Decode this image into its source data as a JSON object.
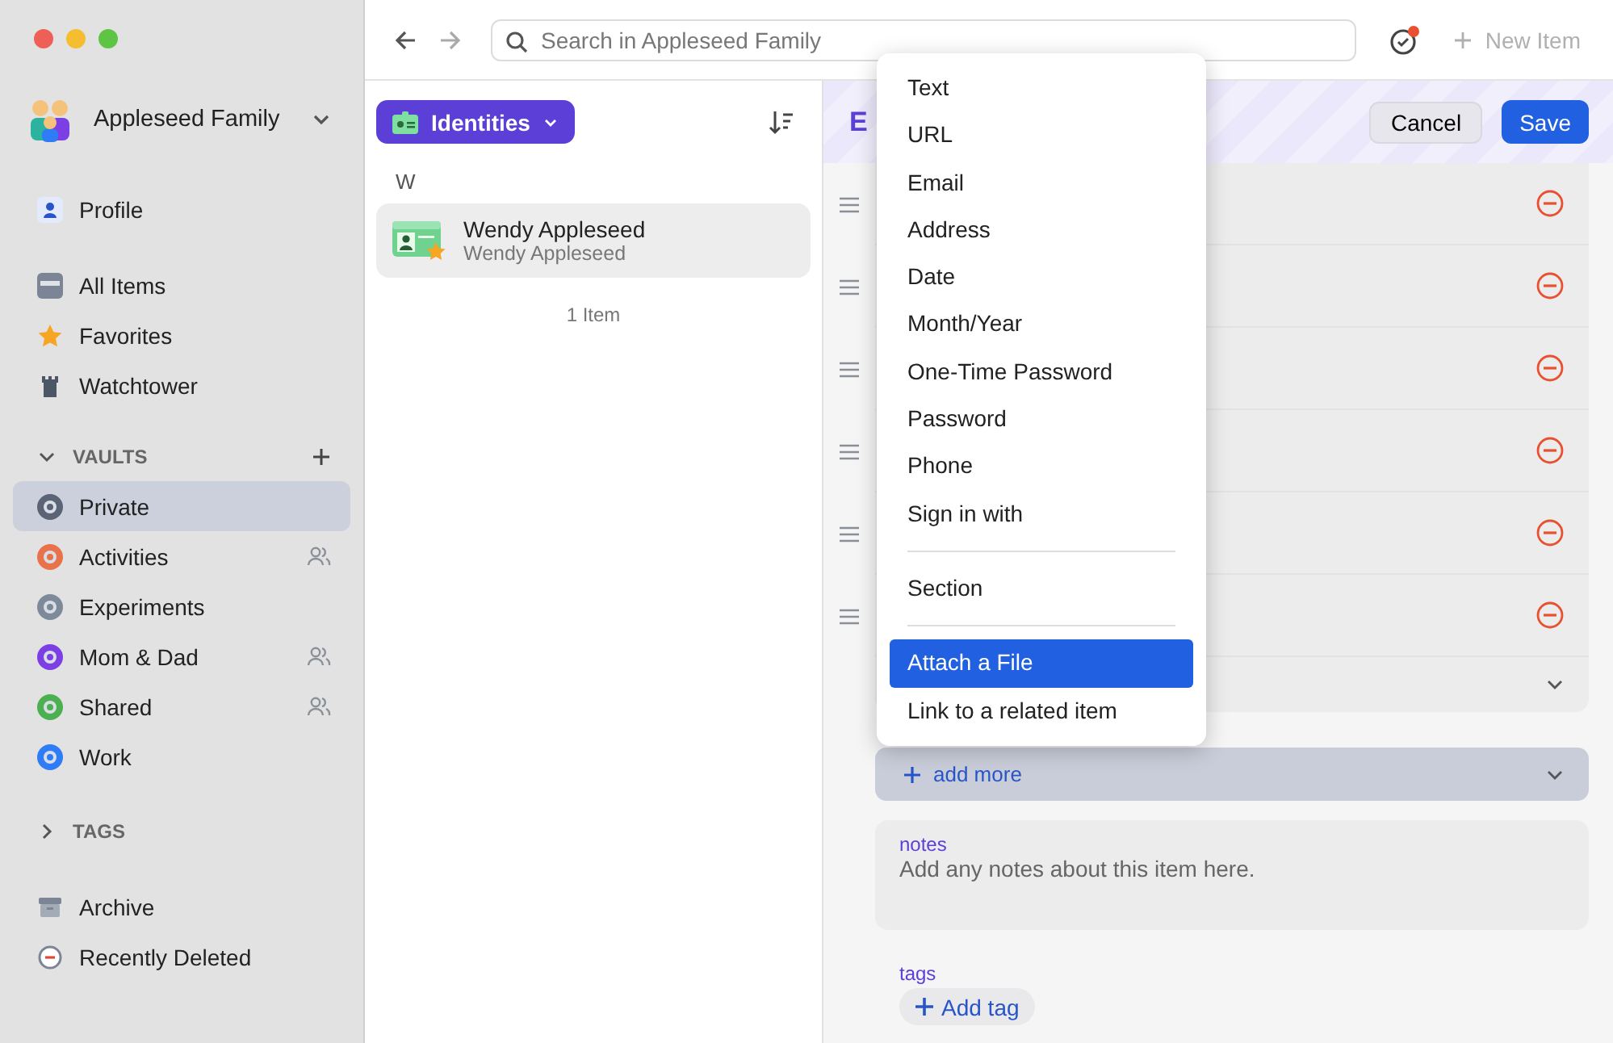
{
  "sidebar": {
    "account": "Appleseed Family",
    "groups": [
      {
        "items": [
          {
            "label": "Profile",
            "selected": false
          }
        ]
      },
      {
        "items": [
          {
            "label": "All Items",
            "selected": false
          },
          {
            "label": "Favorites",
            "selected": false
          },
          {
            "label": "Watchtower",
            "selected": false
          }
        ]
      }
    ],
    "vaults": {
      "title": "VAULTS",
      "expanded": true,
      "items": [
        {
          "label": "Private",
          "selected": true,
          "shared": false
        },
        {
          "label": "Activities",
          "selected": false,
          "shared": true
        },
        {
          "label": "Experiments",
          "selected": false,
          "shared": false
        },
        {
          "label": "Mom & Dad",
          "selected": false,
          "shared": true
        },
        {
          "label": "Shared",
          "selected": false,
          "shared": true
        },
        {
          "label": "Work",
          "selected": false,
          "shared": false
        }
      ]
    },
    "tags": {
      "title": "TAGS",
      "expanded": false
    },
    "bottom": [
      {
        "label": "Archive",
        "selected": false
      },
      {
        "label": "Recently Deleted",
        "selected": false
      }
    ]
  },
  "toolbar": {
    "search": {
      "placeholder": "Search in Appleseed Family"
    },
    "new_item": {
      "label": "New Item",
      "disabled": true
    }
  },
  "list": {
    "filter": "Identities",
    "section": "W",
    "items": [
      {
        "title": "Wendy Appleseed",
        "subtitle": "Wendy Appleseed",
        "selected": true
      }
    ],
    "count": "1 Item"
  },
  "editor": {
    "title": "E",
    "cancel": "Cancel",
    "save": "Save",
    "add_more": "add more",
    "notes": {
      "label": "notes",
      "placeholder": "Add any notes about this item here."
    },
    "tags": {
      "label": "tags",
      "add": "Add tag"
    }
  },
  "menu": {
    "groups": [
      [
        {
          "label": "Text",
          "selected": false
        },
        {
          "label": "URL",
          "selected": false
        },
        {
          "label": "Email",
          "selected": false
        },
        {
          "label": "Address",
          "selected": false
        },
        {
          "label": "Date",
          "selected": false
        },
        {
          "label": "Month/Year",
          "selected": false
        },
        {
          "label": "One-Time Password",
          "selected": false
        },
        {
          "label": "Password",
          "selected": false
        },
        {
          "label": "Phone",
          "selected": false
        },
        {
          "label": "Sign in with",
          "selected": false
        }
      ],
      [
        {
          "label": "Section",
          "selected": false
        }
      ],
      [
        {
          "label": "Attach a File",
          "selected": true
        },
        {
          "label": "Link to a related item",
          "selected": false
        }
      ]
    ]
  }
}
